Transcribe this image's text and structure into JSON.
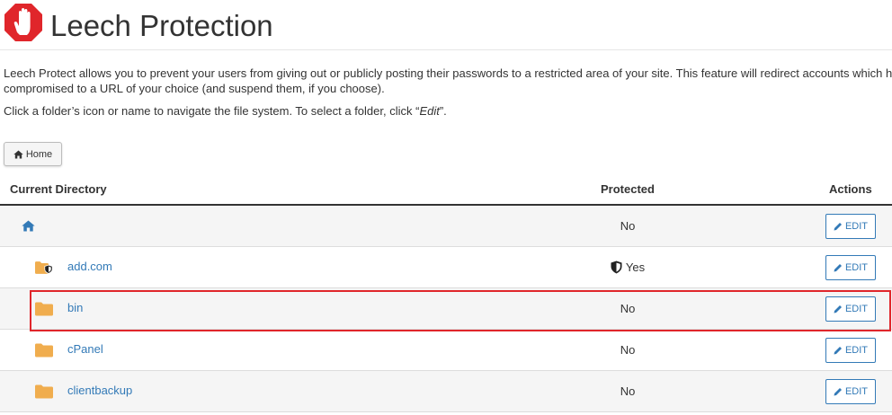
{
  "header": {
    "title": "Leech Protection",
    "icon": "stop-hand-icon",
    "icon_color": "#e0262b"
  },
  "description": {
    "line1": "Leech Protect allows you to prevent your users from giving out or publicly posting their passwords to a restricted area of your site. This feature will redirect accounts which have been",
    "line2": "compromised to a URL of your choice (and suspend them, if you choose)."
  },
  "hint": {
    "before": "Click a folder’s icon or name to navigate the file system. To select a folder, click “",
    "emph": "Edit",
    "after": "”."
  },
  "breadcrumb": {
    "home_label": "Home"
  },
  "table": {
    "headers": {
      "directory": "Current Directory",
      "protected": "Protected",
      "actions": "Actions"
    },
    "rows": [
      {
        "name": "",
        "protected": "No",
        "action": "EDIT",
        "icon": "home-icon"
      },
      {
        "name": "add.com",
        "protected": "Yes",
        "action": "EDIT",
        "icon": "protected-folder-icon"
      },
      {
        "name": "bin",
        "protected": "No",
        "action": "EDIT",
        "icon": "folder-icon"
      },
      {
        "name": "cPanel",
        "protected": "No",
        "action": "EDIT",
        "icon": "folder-icon"
      },
      {
        "name": "clientbackup",
        "protected": "No",
        "action": "EDIT",
        "icon": "folder-icon"
      }
    ]
  },
  "colors": {
    "link": "#337ab7",
    "folder": "#f0ad4e",
    "highlight": "#e0262b"
  }
}
